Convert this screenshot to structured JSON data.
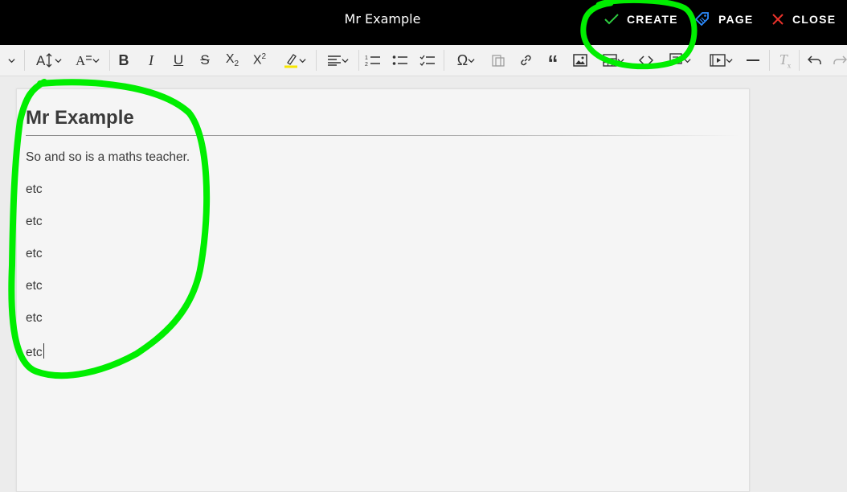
{
  "topbar": {
    "title": "Mr Example",
    "create_label": "CREATE",
    "page_label": "PAGE",
    "close_label": "CLOSE",
    "create_color": "#2ecc40",
    "page_color": "#2d8cff",
    "close_color": "#e8322a"
  },
  "toolbar": {
    "tools": [
      "chevron-down-icon",
      "font-size-icon",
      "font-family-icon",
      "bold-icon",
      "italic-icon",
      "underline-icon",
      "strikethrough-icon",
      "subscript-icon",
      "superscript-icon",
      "highlight-icon",
      "align-icon",
      "numbered-list-icon",
      "bulleted-list-icon",
      "todo-list-icon",
      "special-characters-icon",
      "paste-from-office-icon",
      "link-icon",
      "blockquote-icon",
      "image-icon",
      "table-icon",
      "code-icon",
      "html-embed-icon",
      "media-embed-icon",
      "horizontal-line-icon",
      "remove-format-icon",
      "undo-icon",
      "redo-icon"
    ]
  },
  "document": {
    "heading": "Mr Example",
    "paragraphs": [
      "So and so is a maths teacher.",
      "etc",
      "etc",
      "etc",
      "etc",
      "etc",
      "etc"
    ]
  },
  "annotation_color": "#00ee00"
}
